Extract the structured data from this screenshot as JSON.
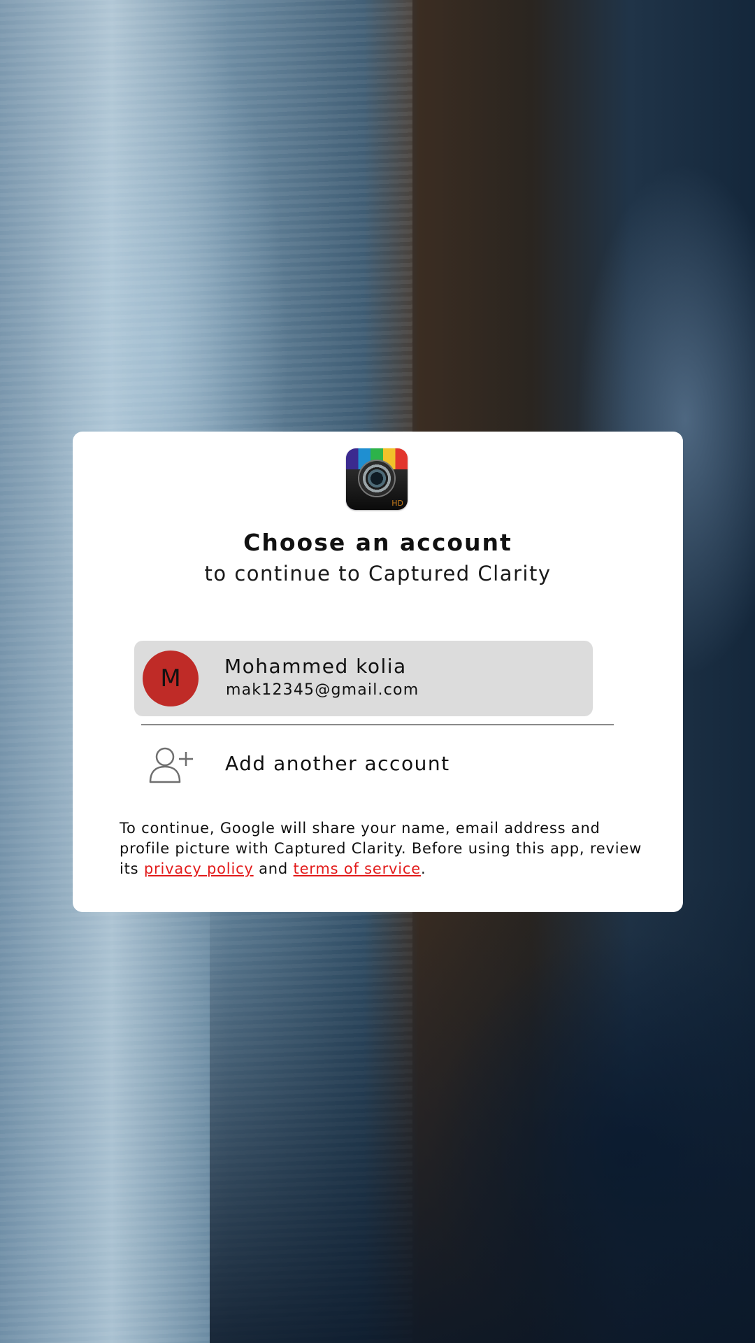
{
  "dialog": {
    "app_icon": {
      "name": "captured-clarity-app-icon",
      "badge": "HD"
    },
    "title": "Choose an account",
    "subtitle": "to continue to Captured Clarity",
    "accounts": [
      {
        "initial": "M",
        "name": "Mohammed kolia",
        "email": "mak12345@gmail.com",
        "avatar_color": "#bf2b27"
      }
    ],
    "add_account": {
      "label": "Add another account",
      "icon": "add-user-icon"
    },
    "disclaimer": {
      "text": "To continue, Google will share your name, email address and profile picture with Captured Clarity. Before using this app, review its ",
      "privacy_link": "privacy policy",
      "and": "and",
      "terms_link": "terms of service",
      "end": "."
    }
  },
  "colors": {
    "link": "#e21b1b",
    "selected_row": "#dcdcdc",
    "dialog_bg": "#ffffff"
  }
}
